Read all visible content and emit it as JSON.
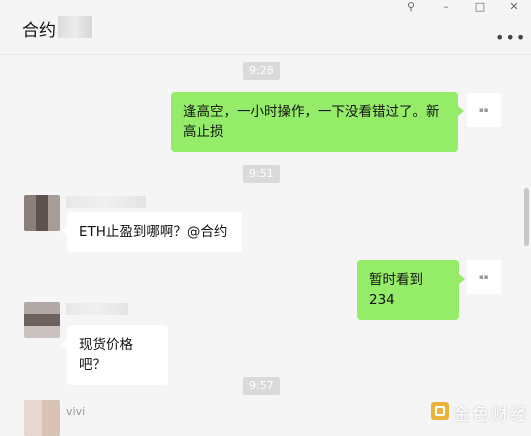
{
  "header": {
    "title": "合约",
    "more_label": "•••",
    "window_controls": {
      "pin": "⚲",
      "minimize": "–",
      "maximize": "□",
      "close": "✕"
    }
  },
  "messages": {
    "t1": "9:28",
    "m1": "逢高空，一小时操作，一下没看错过了。新高止损",
    "t2": "9:51",
    "m2": "ETH止盈到哪啊？@合约",
    "m3": "暂时看到234",
    "m4": "现货价格吧？",
    "t3": "9:57",
    "sender_name": "vivi"
  },
  "watermark": {
    "text": "金色财经"
  },
  "colors": {
    "my_bubble": "#95ec69",
    "other_bubble": "#ffffff",
    "background": "#f5f5f5"
  }
}
